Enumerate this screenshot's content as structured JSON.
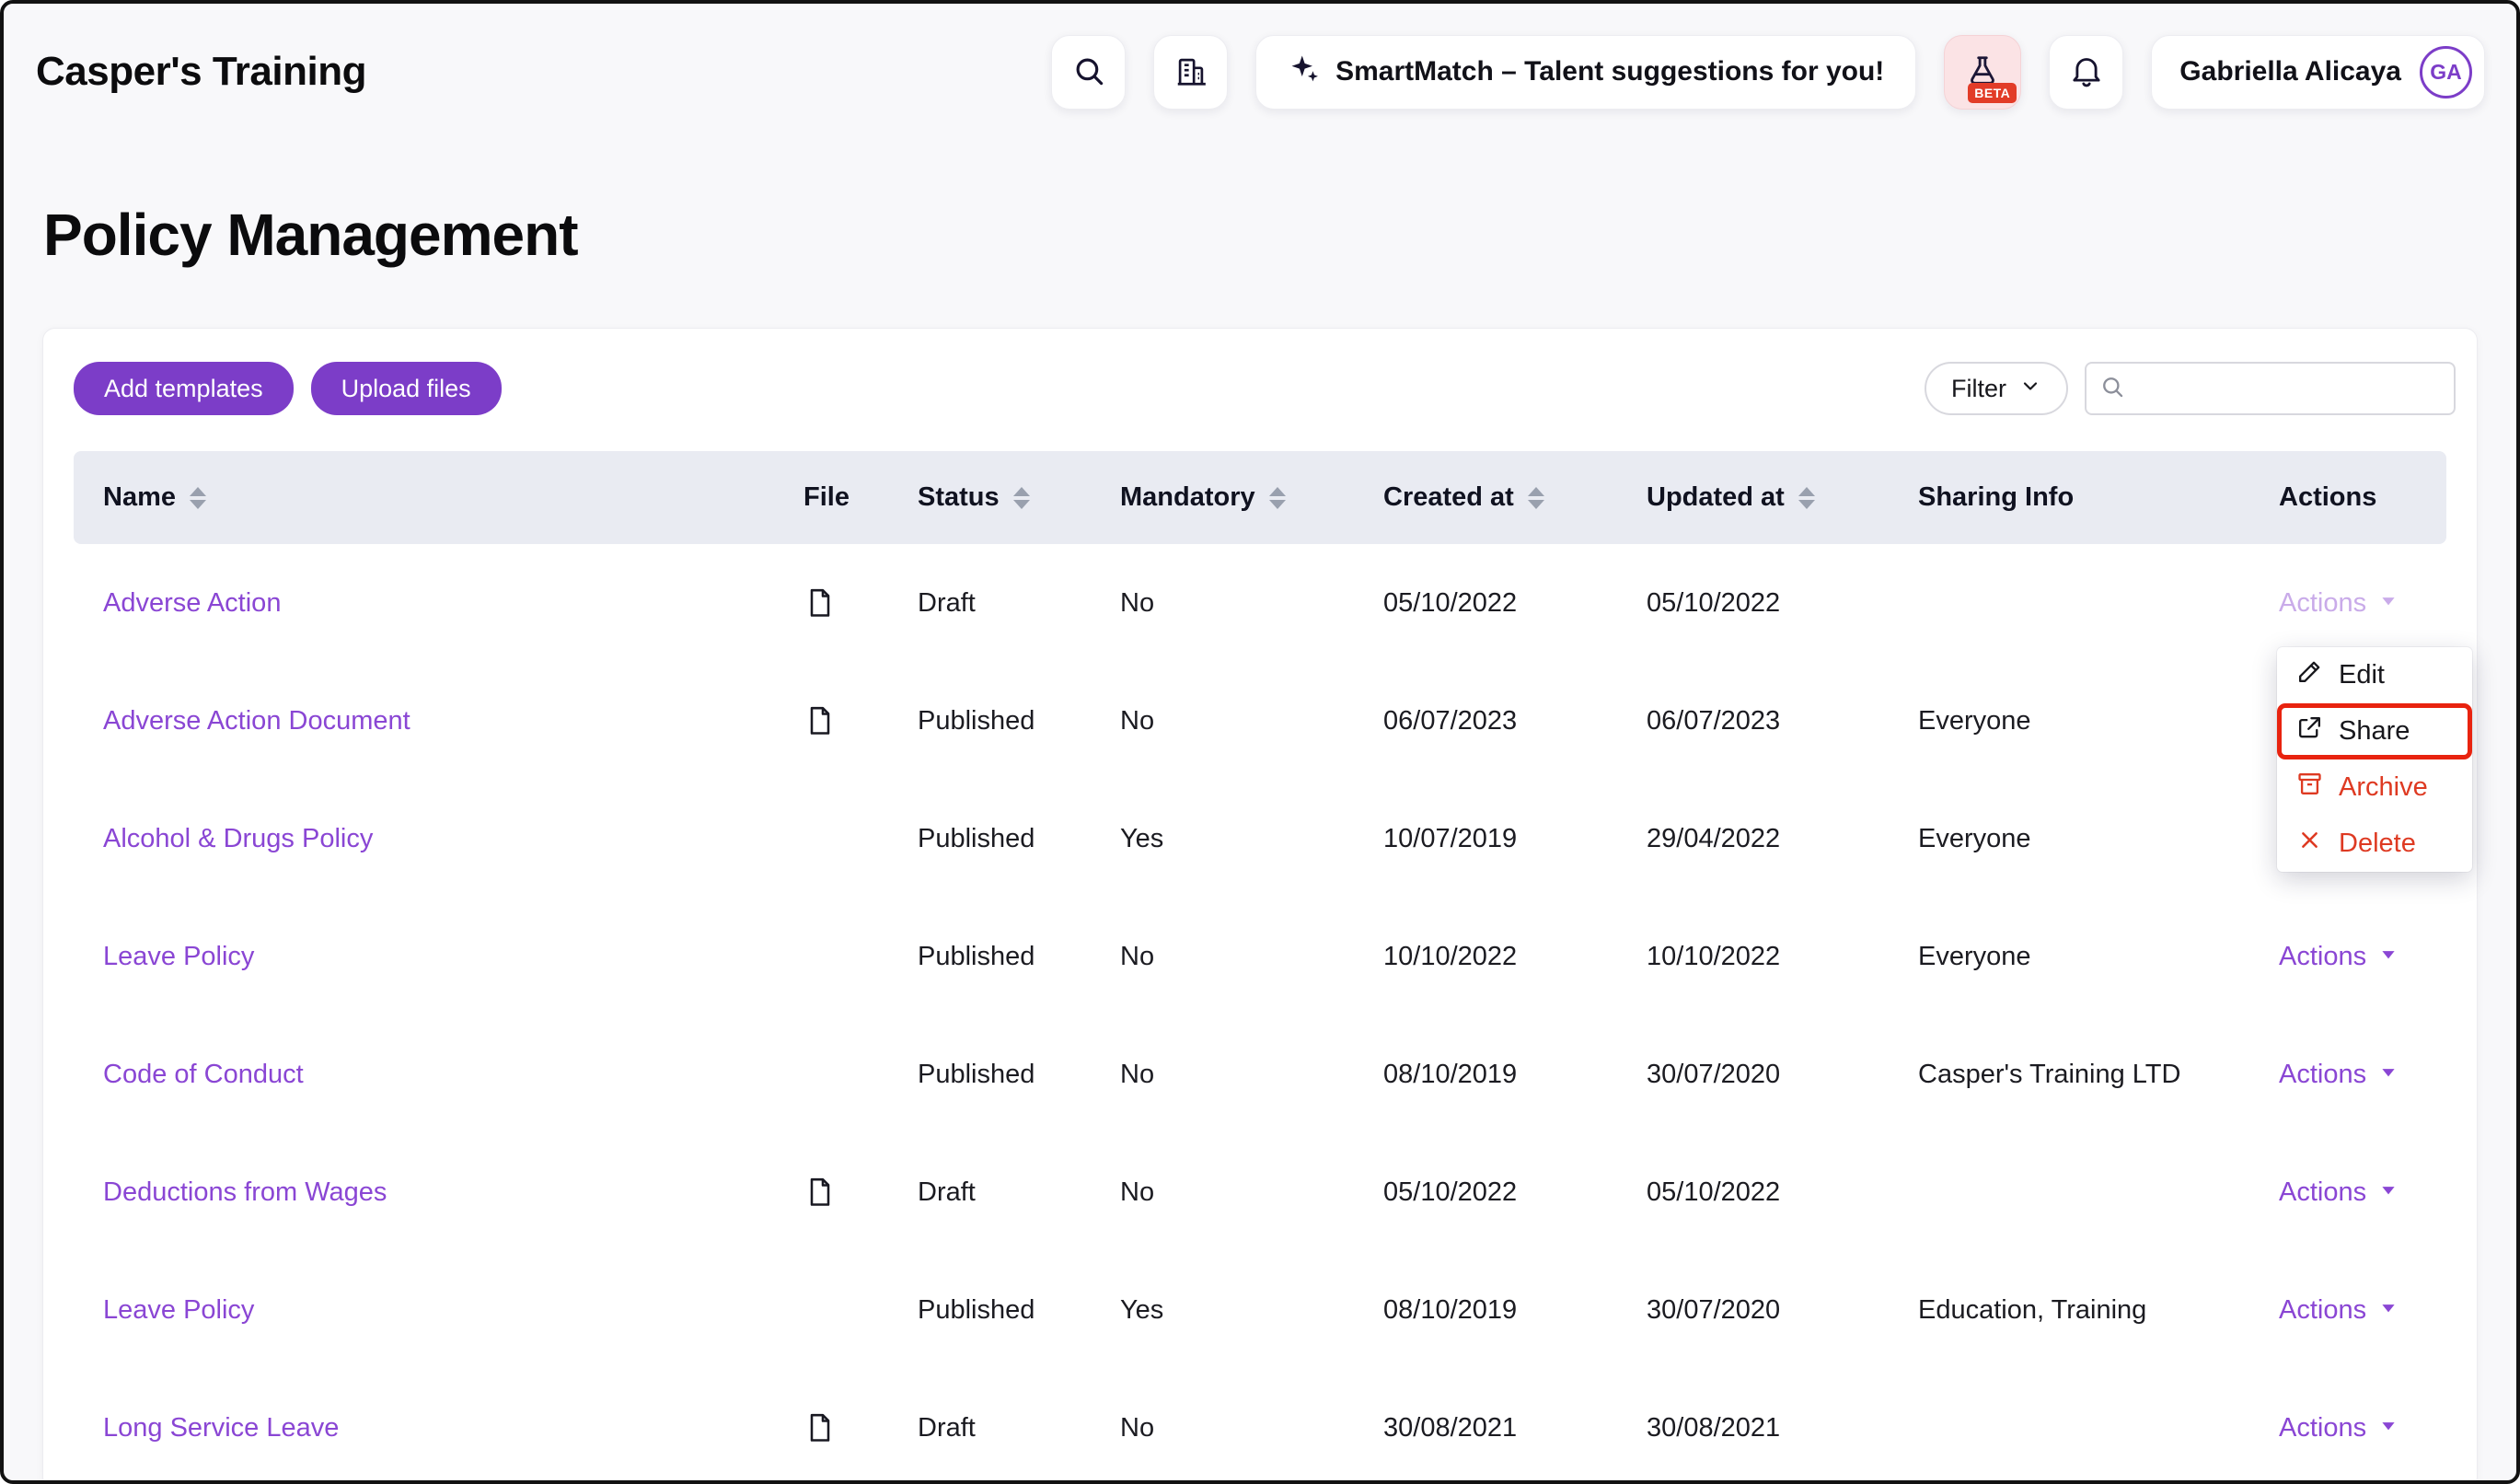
{
  "colors": {
    "accent": "#7c3dc8",
    "link": "#8a46d4",
    "danger": "#de3a22",
    "annotation": "#e8230f",
    "table_header_bg": "#e9ebf2"
  },
  "header": {
    "brand": "Casper's Training",
    "smartmatch_label": "SmartMatch – Talent suggestions for you!",
    "beta_label": "BETA",
    "user_name": "Gabriella Alicaya",
    "user_initials": "GA"
  },
  "page": {
    "title": "Policy Management"
  },
  "toolbar": {
    "add_templates_label": "Add templates",
    "upload_files_label": "Upload files",
    "filter_label": "Filter",
    "search_value": ""
  },
  "table": {
    "actions_label": "Actions",
    "columns": [
      {
        "label": "Name",
        "sortable": true
      },
      {
        "label": "File",
        "sortable": false
      },
      {
        "label": "Status",
        "sortable": true
      },
      {
        "label": "Mandatory",
        "sortable": true
      },
      {
        "label": "Created at",
        "sortable": true
      },
      {
        "label": "Updated at",
        "sortable": true
      },
      {
        "label": "Sharing Info",
        "sortable": false
      },
      {
        "label": "Actions",
        "sortable": false
      }
    ],
    "rows": [
      {
        "name": "Adverse Action",
        "has_file": true,
        "status": "Draft",
        "mandatory": "No",
        "created": "05/10/2022",
        "updated": "05/10/2022",
        "sharing": "",
        "actions_state": "open"
      },
      {
        "name": "Adverse Action Document",
        "has_file": true,
        "status": "Published",
        "mandatory": "No",
        "created": "06/07/2023",
        "updated": "06/07/2023",
        "sharing": "Everyone",
        "actions_state": "hidden"
      },
      {
        "name": "Alcohol & Drugs Policy",
        "has_file": false,
        "status": "Published",
        "mandatory": "Yes",
        "created": "10/07/2019",
        "updated": "29/04/2022",
        "sharing": "Everyone",
        "actions_state": "hidden"
      },
      {
        "name": "Leave Policy",
        "has_file": false,
        "status": "Published",
        "mandatory": "No",
        "created": "10/10/2022",
        "updated": "10/10/2022",
        "sharing": "Everyone",
        "actions_state": "visible"
      },
      {
        "name": "Code of Conduct",
        "has_file": false,
        "status": "Published",
        "mandatory": "No",
        "created": "08/10/2019",
        "updated": "30/07/2020",
        "sharing": "Casper's Training LTD",
        "actions_state": "visible"
      },
      {
        "name": "Deductions from Wages",
        "has_file": true,
        "status": "Draft",
        "mandatory": "No",
        "created": "05/10/2022",
        "updated": "05/10/2022",
        "sharing": "",
        "actions_state": "visible"
      },
      {
        "name": "Leave Policy",
        "has_file": false,
        "status": "Published",
        "mandatory": "Yes",
        "created": "08/10/2019",
        "updated": "30/07/2020",
        "sharing": "Education, Training",
        "actions_state": "visible"
      },
      {
        "name": "Long Service Leave",
        "has_file": true,
        "status": "Draft",
        "mandatory": "No",
        "created": "30/08/2021",
        "updated": "30/08/2021",
        "sharing": "",
        "actions_state": "visible"
      }
    ]
  },
  "actions_menu": {
    "items": [
      {
        "label": "Edit",
        "icon": "pencil-icon",
        "danger": false,
        "annotated": false
      },
      {
        "label": "Share",
        "icon": "share-icon",
        "danger": false,
        "annotated": true
      },
      {
        "label": "Archive",
        "icon": "archive-icon",
        "danger": true,
        "annotated": false
      },
      {
        "label": "Delete",
        "icon": "x-icon",
        "danger": true,
        "annotated": false
      }
    ]
  }
}
